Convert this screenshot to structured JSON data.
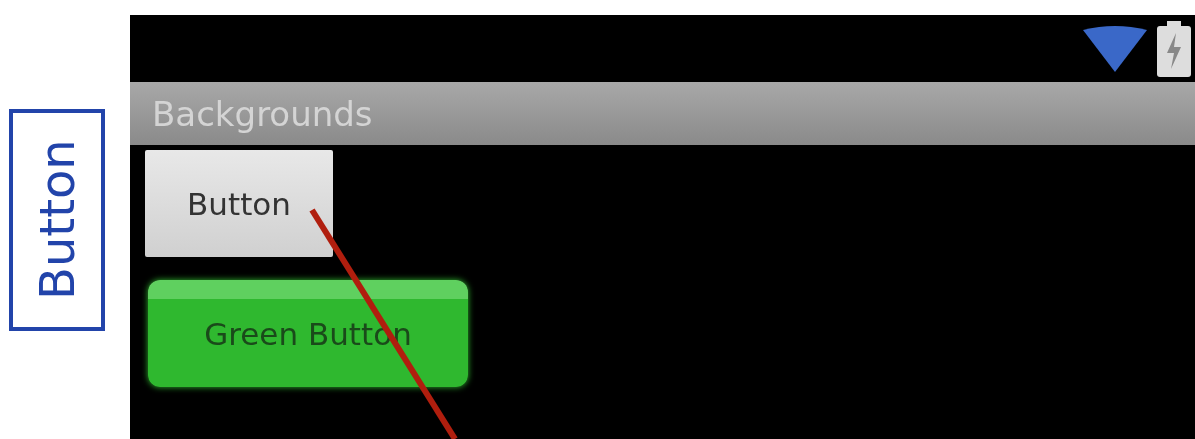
{
  "side_label": "Button",
  "title_bar": {
    "title": "Backgrounds"
  },
  "buttons": [
    {
      "label": "Button",
      "kind": "plain"
    },
    {
      "label": "Green Button",
      "kind": "green"
    }
  ]
}
